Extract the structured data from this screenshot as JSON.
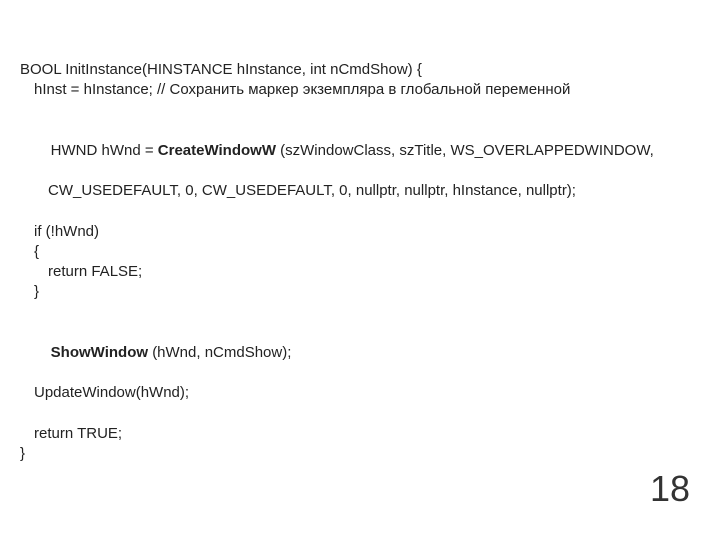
{
  "code": {
    "l1": "BOOL InitInstance(HINSTANCE hInstance, int nCmdShow) {",
    "l2": "hInst = hInstance; // Сохранить маркер экземпляра в глобальной переменной",
    "l3a": "HWND hWnd = ",
    "l3b": "CreateWindowW ",
    "l3c": "(szWindowClass, szTitle, WS_OVERLAPPEDWINDOW,",
    "l4": "CW_USEDEFAULT, 0, CW_USEDEFAULT, 0, nullptr, nullptr, hInstance, nullptr);",
    "l5": "if (!hWnd)",
    "l6": "{",
    "l7": "return FALSE;",
    "l8": "}",
    "l9a": "ShowWindow ",
    "l9b": "(hWnd, nCmdShow);",
    "l10": "UpdateWindow(hWnd);",
    "l11": "return TRUE;",
    "l12": "}"
  },
  "page_number": "18"
}
